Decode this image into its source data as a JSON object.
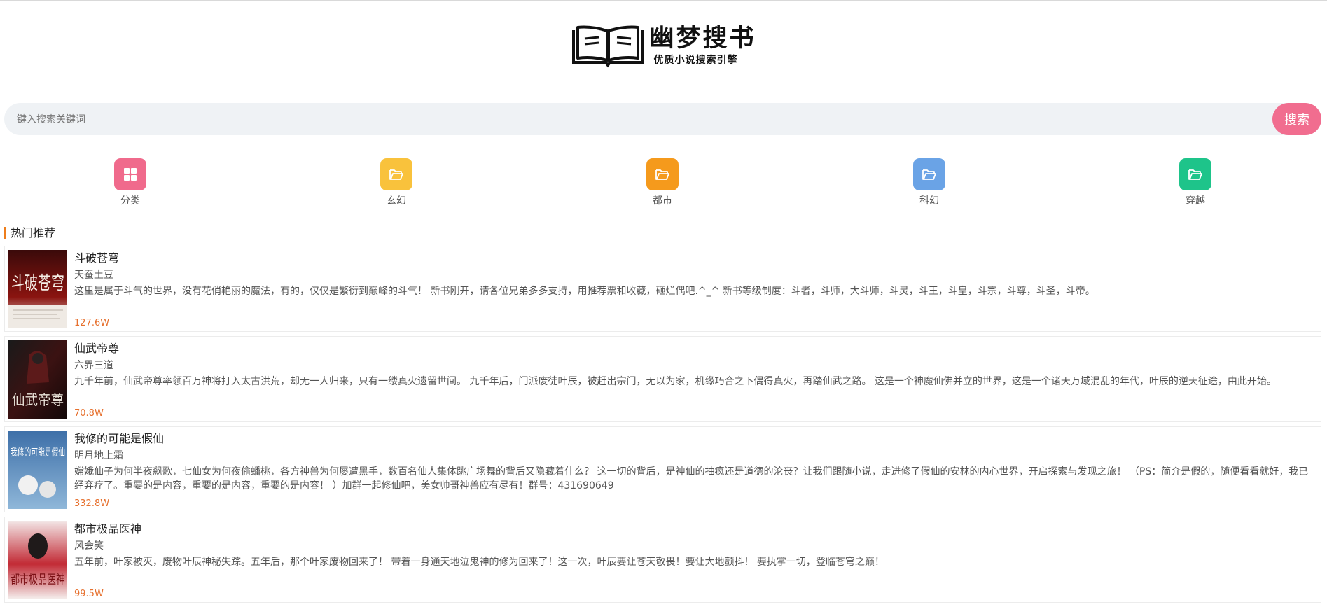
{
  "header": {
    "logo_title": "幽梦搜书",
    "logo_subtitle": "优质小说搜索引擎"
  },
  "search": {
    "placeholder": "键入搜索关键词",
    "value": "",
    "button_label": "搜索"
  },
  "nav": [
    {
      "label": "分类",
      "icon": "grid-icon",
      "color": "#f06a8c"
    },
    {
      "label": "玄幻",
      "icon": "folder-open-icon",
      "color": "#f9c23c"
    },
    {
      "label": "都市",
      "icon": "folder-open-icon",
      "color": "#f59a1c"
    },
    {
      "label": "科幻",
      "icon": "folder-open-icon",
      "color": "#6aa3e6"
    },
    {
      "label": "穿越",
      "icon": "folder-open-icon",
      "color": "#1ec48a"
    }
  ],
  "section": {
    "title": "热门推荐",
    "accent": "#ee7d1b"
  },
  "books": [
    {
      "title": "斗破苍穹",
      "author": "天蚕土豆",
      "description": "这里是属于斗气的世界，没有花俏艳丽的魔法，有的，仅仅是繁衍到巅峰的斗气！ 新书刚开，请各位兄弟多多支持，用推荐票和收藏，砸烂偶吧.^_^ 新书等级制度：斗者，斗师，大斗师，斗灵，斗王，斗皇，斗宗，斗尊，斗圣，斗帝。",
      "count": "127.6W",
      "cover_text": "斗破苍穹"
    },
    {
      "title": "仙武帝尊",
      "author": "六界三道",
      "description": "九千年前，仙武帝尊率领百万神将打入太古洪荒，却无一人归来，只有一缕真火遗留世间。 九千年后，门派废徒叶辰，被赶出宗门，无以为家，机缘巧合之下偶得真火，再踏仙武之路。 这是一个神魔仙佛并立的世界，这是一个诸天万域混乱的年代，叶辰的逆天征途，由此开始。",
      "count": "70.8W",
      "cover_text": "仙武帝尊"
    },
    {
      "title": "我修的可能是假仙",
      "author": "明月地上霜",
      "description": "嫦娥仙子为何半夜飙歌，七仙女为何夜偷蟠桃，各方神兽为何屡遭黑手，数百名仙人集体跳广场舞的背后又隐藏着什么？ 这一切的背后，是神仙的抽疯还是道德的沦丧？让我们跟随小说，走进修了假仙的安林的内心世界，开启探索与发现之旅！ （PS：简介是假的，随便看看就好，我已经弃疗了。重要的是内容，重要的是内容，重要的是内容！ ）加群一起修仙吧，美女帅哥神兽应有尽有！群号：431690649",
      "count": "332.8W",
      "cover_text": "我修的可能是假仙"
    },
    {
      "title": "都市极品医神",
      "author": "风会笑",
      "description": "五年前，叶家被灭，废物叶辰神秘失踪。五年后，那个叶家废物回来了！ 带着一身通天地泣鬼神的修为回来了！这一次，叶辰要让苍天敬畏！要让大地颤抖！ 要执掌一切，登临苍穹之巅！",
      "count": "99.5W",
      "cover_text": "都市极品医神"
    }
  ]
}
